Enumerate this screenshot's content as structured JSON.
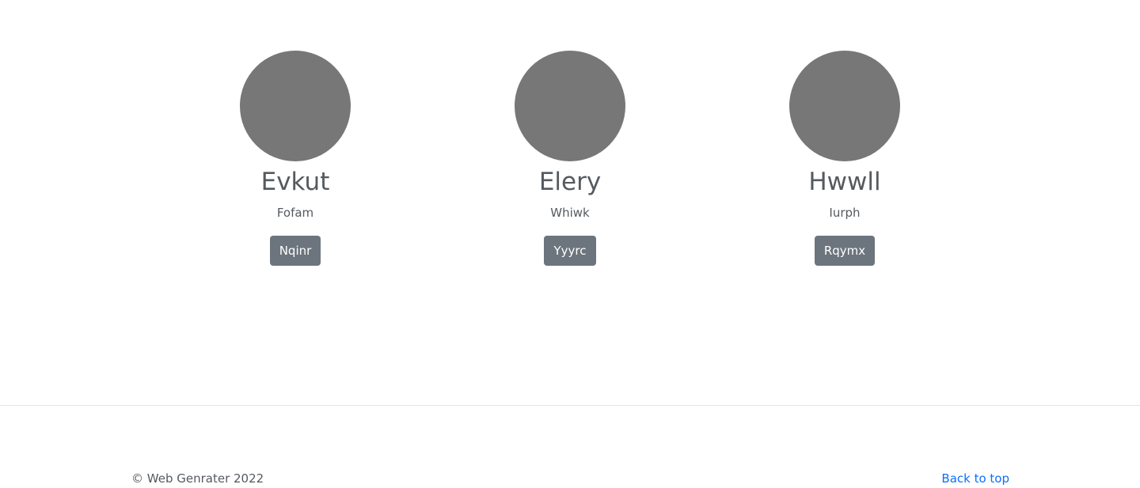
{
  "team": [
    {
      "name": "Evkut",
      "subtitle": "Fofam",
      "button_label": "Nqinr"
    },
    {
      "name": "Elery",
      "subtitle": "Whiwk",
      "button_label": "Yyyrc"
    },
    {
      "name": "Hwwll",
      "subtitle": "Iurph",
      "button_label": "Rqymx"
    }
  ],
  "footer": {
    "copyright": "© Web Genrater 2022",
    "back_to_top": "Back to top"
  },
  "colors": {
    "avatar": "#777777",
    "button": "#6c757d",
    "link": "#0d6efd"
  }
}
